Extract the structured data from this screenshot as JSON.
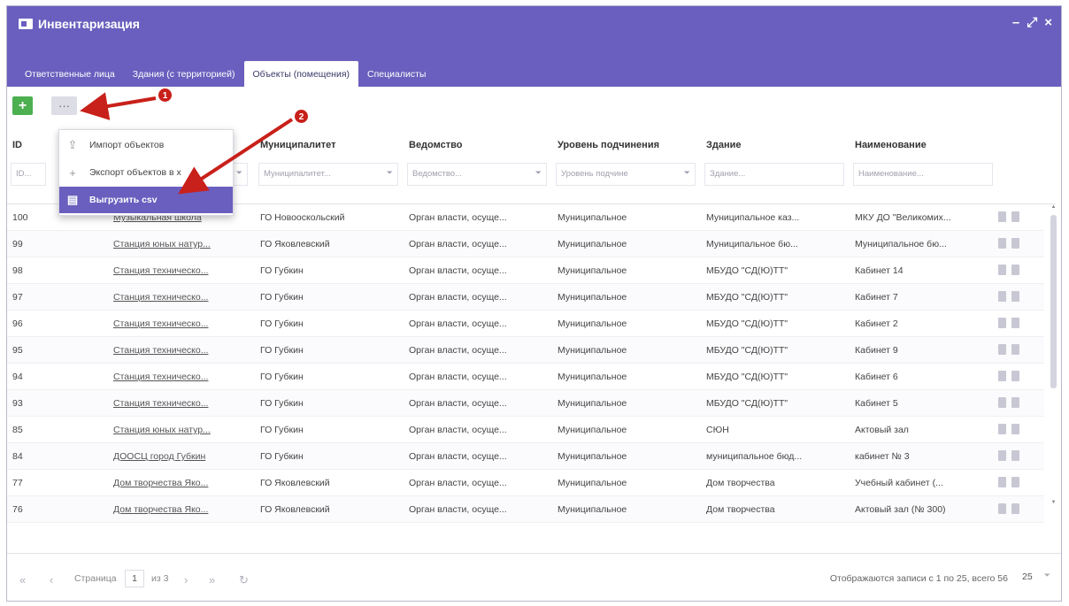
{
  "window": {
    "title": "Инвентаризация",
    "controls": [
      "–",
      "⤢",
      "×"
    ]
  },
  "tabs": [
    {
      "label": "Ответственные лица",
      "active": false
    },
    {
      "label": "Здания (с территорией)",
      "active": false
    },
    {
      "label": "Объекты (помещения)",
      "active": true
    },
    {
      "label": "Специалисты",
      "active": false
    }
  ],
  "toolbar": {
    "add_label": "+",
    "more_label": "···"
  },
  "menu": {
    "items": [
      {
        "icon": "upload-icon",
        "label": "Импорт объектов"
      },
      {
        "icon": "plus-icon",
        "label": "Экспорт объектов в x"
      },
      {
        "icon": "file-icon",
        "label": "Выгрузить csv",
        "selected": true
      }
    ]
  },
  "annotations": {
    "badge1": "1",
    "badge2": "2"
  },
  "columns": [
    {
      "title": "ID",
      "filter": "ID..."
    },
    {
      "title": "",
      "filter": ""
    },
    {
      "title": "Муниципалитет",
      "filter": "Муниципалитет..."
    },
    {
      "title": "Ведомство",
      "filter": "Ведомство..."
    },
    {
      "title": "Уровень подчинения",
      "filter": "Уровень подчине"
    },
    {
      "title": "Здание",
      "filter": "Здание..."
    },
    {
      "title": "Наименование",
      "filter": "Наименование..."
    }
  ],
  "rows": [
    [
      "100",
      "Музыкальная школа",
      "ГО Новооскольский",
      "Орган власти, осуще...",
      "Муниципальное",
      "Муниципальное каз...",
      "МКУ ДО \"Великомих..."
    ],
    [
      "99",
      "Станция юных натур...",
      "ГО Яковлевский",
      "Орган власти, осуще...",
      "Муниципальное",
      "Муниципальное бю...",
      "Муниципальное бю..."
    ],
    [
      "98",
      "Станция техническо...",
      "ГО Губкин",
      "Орган власти, осуще...",
      "Муниципальное",
      "МБУДО \"СД(Ю)ТТ\"",
      "Кабинет 14"
    ],
    [
      "97",
      "Станция техническо...",
      "ГО Губкин",
      "Орган власти, осуще...",
      "Муниципальное",
      "МБУДО \"СД(Ю)ТТ\"",
      "Кабинет 7"
    ],
    [
      "96",
      "Станция техническо...",
      "ГО Губкин",
      "Орган власти, осуще...",
      "Муниципальное",
      "МБУДО \"СД(Ю)ТТ\"",
      "Кабинет 2"
    ],
    [
      "95",
      "Станция техническо...",
      "ГО Губкин",
      "Орган власти, осуще...",
      "Муниципальное",
      "МБУДО \"СД(Ю)ТТ\"",
      "Кабинет 9"
    ],
    [
      "94",
      "Станция техническо...",
      "ГО Губкин",
      "Орган власти, осуще...",
      "Муниципальное",
      "МБУДО \"СД(Ю)ТТ\"",
      "Кабинет 6"
    ],
    [
      "93",
      "Станция техническо...",
      "ГО Губкин",
      "Орган власти, осуще...",
      "Муниципальное",
      "МБУДО \"СД(Ю)ТТ\"",
      "Кабинет 5"
    ],
    [
      "85",
      "Станция юных натур...",
      "ГО Губкин",
      "Орган власти, осуще...",
      "Муниципальное",
      "СЮН",
      "Актовый зал"
    ],
    [
      "84",
      "ДООСЦ город Губкин",
      "ГО Губкин",
      "Орган власти, осуще...",
      "Муниципальное",
      "муниципальное бюд...",
      "кабинет № 3"
    ],
    [
      "77",
      "Дом творчества Яко...",
      "ГО Яковлевский",
      "Орган власти, осуще...",
      "Муниципальное",
      "Дом творчества",
      "Учебный кабинет (..."
    ],
    [
      "76",
      "Дом творчества Яко...",
      "ГО Яковлевский",
      "Орган власти, осуще...",
      "Муниципальное",
      "Дом творчества",
      "Актовый зал (№ 300)"
    ]
  ],
  "pager": {
    "page_label": "Страница",
    "page": "1",
    "of_label": "из 3",
    "records": "Отображаются записи с 1 по 25, всего 56",
    "page_size": "25"
  }
}
